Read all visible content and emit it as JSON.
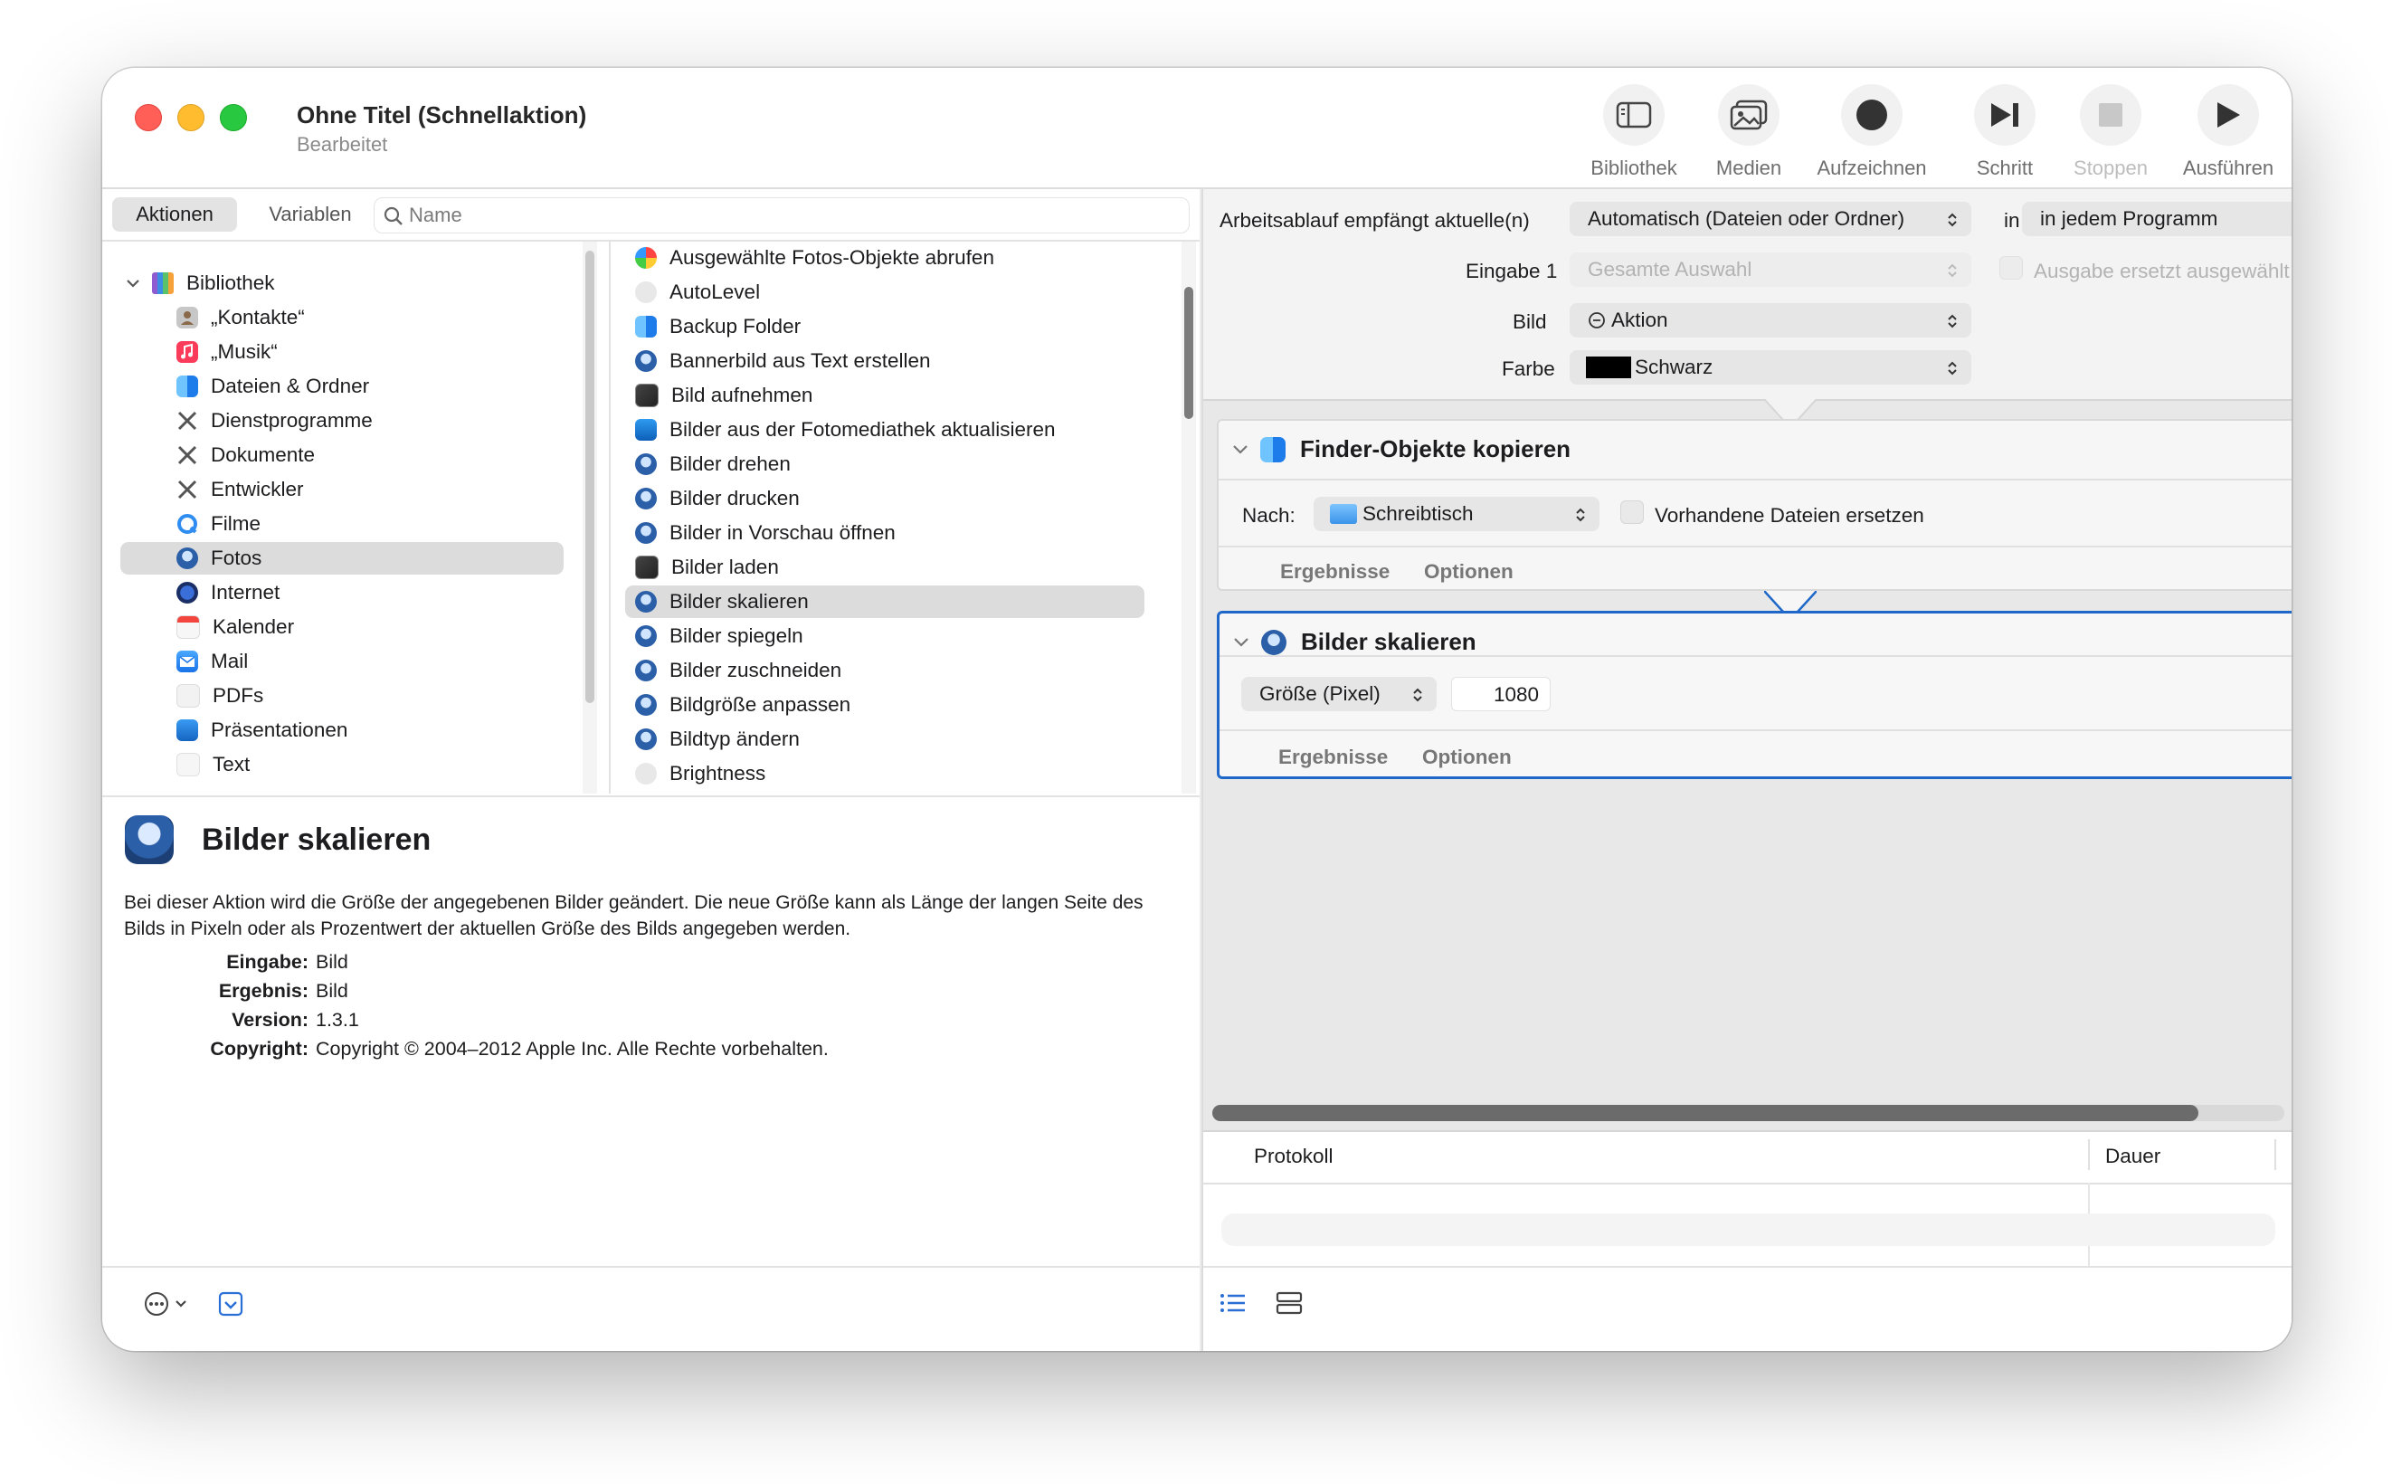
{
  "window": {
    "title": "Ohne Titel (Schnellaktion)",
    "subtitle": "Bearbeitet"
  },
  "toolbar": {
    "library": "Bibliothek",
    "media": "Medien",
    "record": "Aufzeichnen",
    "step": "Schritt",
    "stop": "Stoppen",
    "run": "Ausführen"
  },
  "tabs": {
    "actions": "Aktionen",
    "variables": "Variablen"
  },
  "search": {
    "placeholder": "Name"
  },
  "library": {
    "root": "Bibliothek",
    "items": [
      "„Kontakte“",
      "„Musik“",
      "Dateien & Ordner",
      "Dienstprogramme",
      "Dokumente",
      "Entwickler",
      "Filme",
      "Fotos",
      "Internet",
      "Kalender",
      "Mail",
      "PDFs",
      "Präsentationen",
      "Text"
    ]
  },
  "actions": [
    "Ausgewählte Fotos-Objekte abrufen",
    "AutoLevel",
    "Backup Folder",
    "Bannerbild aus Text erstellen",
    "Bild aufnehmen",
    "Bilder aus der Fotomediathek aktualisieren",
    "Bilder drehen",
    "Bilder drucken",
    "Bilder in Vorschau öffnen",
    "Bilder laden",
    "Bilder skalieren",
    "Bilder spiegeln",
    "Bilder zuschneiden",
    "Bildgröße anpassen",
    "Bildtyp ändern",
    "Brightness"
  ],
  "description": {
    "title": "Bilder skalieren",
    "text": "Bei dieser Aktion wird die Größe der angegebenen Bilder geändert. Die neue Größe kann als Länge der langen Seite des Bilds in Pixeln oder als Prozentwert der aktuellen Größe des Bilds angegeben werden.",
    "input_label": "Eingabe:",
    "input": "Bild",
    "result_label": "Ergebnis:",
    "result": "Bild",
    "version_label": "Version:",
    "version": "1.3.1",
    "copyright_label": "Copyright:",
    "copyright": "Copyright © 2004–2012 Apple Inc. Alle Rechte vorbehalten."
  },
  "workflow": {
    "receives_label": "Arbeitsablauf empfängt aktuelle(n)",
    "receives_value": "Automatisch (Dateien oder Ordner)",
    "in_label": "in",
    "in_value": "in jedem Programm",
    "input_label": "Eingabe 1",
    "input_value": "Gesamte Auswahl",
    "replace_label": "Ausgabe ersetzt ausgewählt",
    "image_label": "Bild",
    "image_value": "Aktion",
    "color_label": "Farbe",
    "color_value": "Schwarz"
  },
  "card_copy": {
    "title": "Finder-Objekte kopieren",
    "to_label": "Nach:",
    "to_value": "Schreibtisch",
    "replace_label": "Vorhandene Dateien ersetzen",
    "results": "Ergebnisse",
    "options": "Optionen"
  },
  "card_scale": {
    "title": "Bilder skalieren",
    "mode_value": "Größe (Pixel)",
    "size_value": "1080",
    "results": "Ergebnisse",
    "options": "Optionen"
  },
  "log": {
    "col_log": "Protokoll",
    "col_duration": "Dauer"
  },
  "colors": {
    "accent": "#1f68c9",
    "selection": "#dcdcdc"
  }
}
